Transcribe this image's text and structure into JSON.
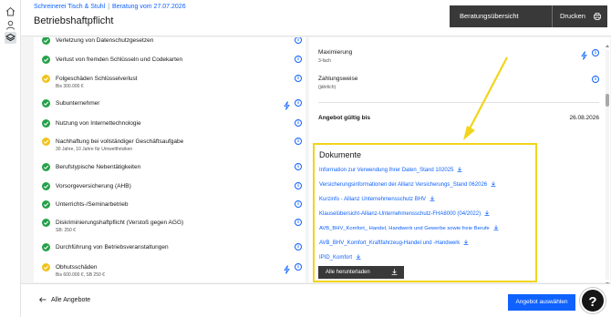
{
  "header": {
    "breadcrumb_1": "Schreinerei Tisch & Stuhl",
    "breadcrumb_2": "Beratung vom 27.07.2026",
    "title": "Betriebshaftpflicht",
    "overview_button": "Beratungsübersicht",
    "print_button": "Drucken"
  },
  "sidebar": {
    "icons": [
      "home-icon",
      "user-icon",
      "layers-icon"
    ]
  },
  "coverage": {
    "rows": [
      {
        "name": "Verletzung von Datenschutzgesetzen",
        "status": "ok"
      },
      {
        "name": "Verlust von fremden Schlüsseln und Codekarten",
        "status": "ok"
      },
      {
        "name": "Folgeschäden Schlüsselverlust",
        "sub": "Bis 300.000 €",
        "status": "warn"
      },
      {
        "name": "Subunternehmer",
        "status": "ok",
        "bolt": true
      },
      {
        "name": "Nutzung von Internettechnologie",
        "status": "ok"
      },
      {
        "name": "Nachhaftung bei vollständiger Geschäftsaufgabe",
        "sub": "30 Jahre, 10 Jahre für Umwelthrisiken",
        "status": "warn"
      },
      {
        "name": "Berufstypische Nebentätigkeiten",
        "status": "ok"
      },
      {
        "name": "Vorsorgeversicherung (AHB)",
        "status": "ok"
      },
      {
        "name": "Unterrichts-/Seminarbetrieb",
        "status": "ok"
      },
      {
        "name": "Diskriminierungshaftpflicht (Verstoß gegen AGG)",
        "sub": "SB: 250 €",
        "status": "ok"
      },
      {
        "name": "Durchführung von Betriebsveranstaltungen",
        "status": "ok"
      },
      {
        "name": "Obhutsschäden",
        "sub": "Bis 600.000 €, SB 250 €",
        "status": "warn",
        "bolt": true
      }
    ]
  },
  "details": {
    "maximierung_label": "Maximierung",
    "maximierung_value": "3-fach",
    "zahlungsweise_label": "Zahlungsweise",
    "zahlungsweise_value": "(jährlich)",
    "angebot_label": "Angebot gültig bis",
    "angebot_date": "26.08.2026"
  },
  "documents": {
    "title": "Dokumente",
    "links": [
      "Information zur Verwendung Ihrer Daten_Stand 102025",
      "Versicherungsinformationen der Allianz Versicherungs_Stand 062026",
      "Kurzinfo - Allianz Unternehmensschutz BHV",
      "Klauselübersicht-Allianz-Unternehmensschutz-FHA8000 (04/2022)",
      "AVB_BHV_Komfort_ Handel, Handwerk und Gewerbe sowie freie Berufe",
      "AVB_BHV_Komfort_Kraftfahrzeug-Handel und -Handwerk",
      "IPID_Komfort"
    ],
    "download_all": "Alle herunterladen"
  },
  "footer": {
    "back_label": "Alle Angebote",
    "select_label": "Angebot auswählen",
    "help_label": "?"
  },
  "colors": {
    "primary": "#0f62fe",
    "dark": "#393939",
    "ok": "#24a148",
    "warn": "#f1c21b",
    "highlight": "#f1d51a"
  }
}
